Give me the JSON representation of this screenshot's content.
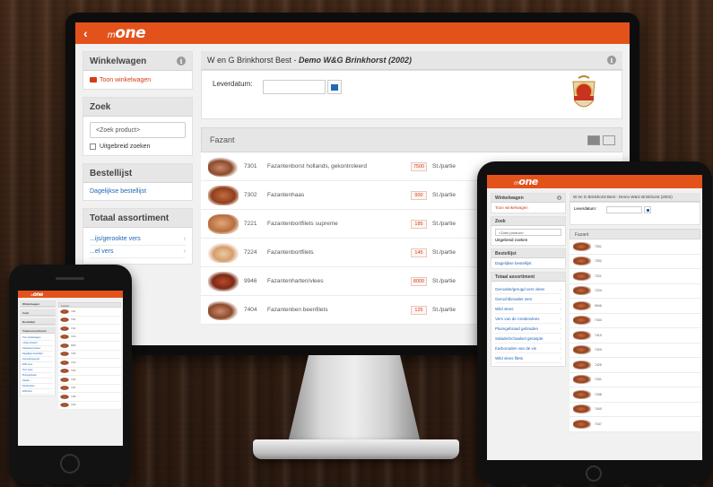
{
  "app": {
    "logo_prefix": "m",
    "logo_text": "one",
    "back_label": "‹"
  },
  "monitor": {
    "sidebar": {
      "cart_title": "Winkelwagen",
      "cart_link": "Toon winkelwagen",
      "search_title": "Zoek",
      "search_placeholder": "<Zoek product>",
      "extended_search_label": "Uitgebreid zoeken",
      "orderlist_title": "Bestellijst",
      "orderlist_link": "Dagelijkse bestellijst",
      "assortment_title": "Totaal assortiment",
      "assortment_items": [
        "...ijs/gerookte vers",
        "...el vers"
      ]
    },
    "main": {
      "title_plain": "W en G Brinkhorst Best - ",
      "title_bold": "Demo W&G Brinkhorst (2002)",
      "date_label": "Leverdatum:",
      "category": "Fazant",
      "products": [
        {
          "code": "7301",
          "name": "Fazantenborst hollands, gekontroleerd",
          "price": "7500",
          "unit": "St./partie",
          "style": "s1"
        },
        {
          "code": "7302",
          "name": "Fazantenhaas",
          "price": "900",
          "unit": "St./partie",
          "style": "s2"
        },
        {
          "code": "7221",
          "name": "Fazantenbortfilets supreme",
          "price": "185",
          "unit": "St./partie",
          "style": "s3"
        },
        {
          "code": "7224",
          "name": "Fazantenbortfilets",
          "price": "145",
          "unit": "St./partie",
          "style": "s4"
        },
        {
          "code": "9946",
          "name": "Fazantenharten/vlees",
          "price": "8000",
          "unit": "St./partie",
          "style": "s5"
        },
        {
          "code": "7404",
          "name": "Fazantenben beenfilets",
          "price": "125",
          "unit": "St./partie",
          "style": "s1"
        }
      ]
    }
  },
  "tablet": {
    "sidebar": {
      "cart_title": "Winkelwagen",
      "cart_link": "Toon winkelwagen",
      "search_title": "Zoek",
      "search_placeholder": "<Zoek product>",
      "extended_search_label": "Uitgebreid zoeken",
      "orderlist_title": "Bestellijst",
      "orderlist_link": "Dagelijkse bestellijst",
      "assortment_title": "Totaal assortiment",
      "assortment_items": [
        "Gerookte/gerugd vers vlees",
        "Geruchtbroeder vers",
        "Wild vlees",
        "Vers van de rondenvlees",
        "Pluimgebraad gebraden",
        "Salade/Schaalsel geraspte",
        "Karbonaden van de vis",
        "Wild vlees filets"
      ]
    },
    "main": {
      "title": "W en G Brinkhorst Best - Demo W&G Brinkhorst (2002)",
      "date_label": "Leverdatum:",
      "category": "Fazant",
      "product_codes": [
        "7301",
        "7302",
        "7221",
        "7224",
        "9946",
        "7404",
        "7410",
        "7420",
        "7425",
        "7431",
        "7438",
        "7440",
        "7447"
      ]
    }
  },
  "phone": {
    "sidebar": {
      "cart_title": "Winkelwagen",
      "search_title": "Zoek",
      "orderlist_title": "Bestellijst",
      "assortment_title": "Totaal assortiment",
      "links": [
        "Toon winkelwagen",
        "<Zoek product>",
        "Uitgebreid zoeken",
        "Dagelijkse bestellijst",
        "Gerookte/gerugd",
        "Wild vlees",
        "Vers vlees",
        "Pluimgebraad",
        "Salade",
        "Karbonaden",
        "Wild filets"
      ]
    },
    "main": {
      "category": "Fazant",
      "product_codes": [
        "7301",
        "7302",
        "7221",
        "7224",
        "9946",
        "7404",
        "7410",
        "7420",
        "7425",
        "7431",
        "7438",
        "7440"
      ]
    }
  }
}
